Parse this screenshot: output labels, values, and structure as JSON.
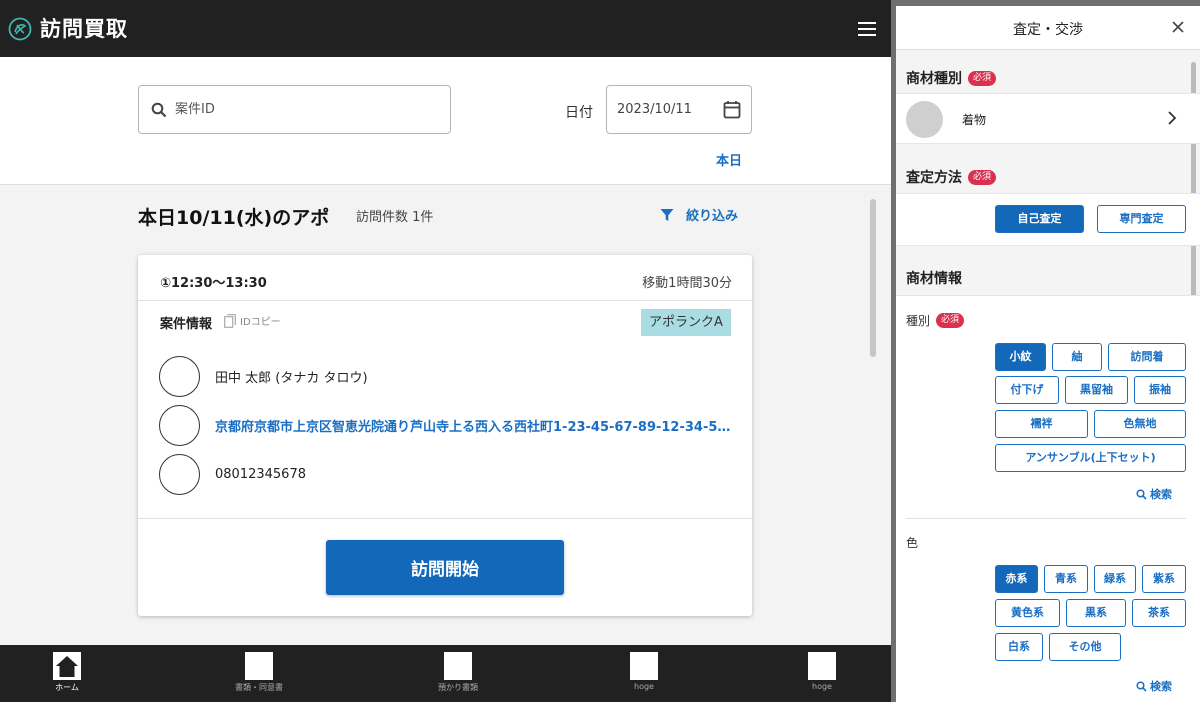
{
  "app": {
    "title": "訪問買取",
    "search_placeholder": "案件ID",
    "date_label": "日付",
    "date_value": "2023/10/11",
    "today_link": "本日",
    "section_title": "本日10/11(水)のアポ",
    "visit_count": "訪問件数 1件",
    "filter_label": "絞り込み"
  },
  "card": {
    "time": "①12:30〜13:30",
    "move": "移動1時間30分",
    "case_label": "案件情報",
    "copy_label": "IDコピー",
    "rank": "アポランクA",
    "name": "田中 太郎 (タナカ タロウ)",
    "address": "京都府京都市上京区智恵光院通り芦山寺上る西入る西社町1-23-45-67-89-12-34-5…",
    "phone": "08012345678",
    "start_button": "訪問開始"
  },
  "bottom_nav": [
    {
      "label": "ホーム"
    },
    {
      "label": "書類・同意書"
    },
    {
      "label": "預かり書類"
    },
    {
      "label": "hoge"
    },
    {
      "label": "hoge"
    }
  ],
  "panel": {
    "title": "査定・交渉",
    "required": "必須",
    "item_type_title": "商材種別",
    "item_type_value": "着物",
    "method_title": "査定方法",
    "method_self": "自己査定",
    "method_pro": "専門査定",
    "info_title": "商材情報",
    "kind_label": "種別",
    "kinds": [
      "小紋",
      "紬",
      "訪問着",
      "付下げ",
      "黒留袖",
      "振袖",
      "襦袢",
      "色無地",
      "アンサンブル(上下セット)"
    ],
    "search_label": "検索",
    "color_label": "色",
    "colors": [
      "赤系",
      "青系",
      "緑系",
      "紫系",
      "黄色系",
      "黒系",
      "茶系",
      "白系",
      "その他"
    ]
  },
  "colors": {
    "accent": "#1468ba",
    "link": "#1a6fc4",
    "topbar": "#212121",
    "required_badge": "#d9314f",
    "rank_badge": "#a9dde3"
  }
}
